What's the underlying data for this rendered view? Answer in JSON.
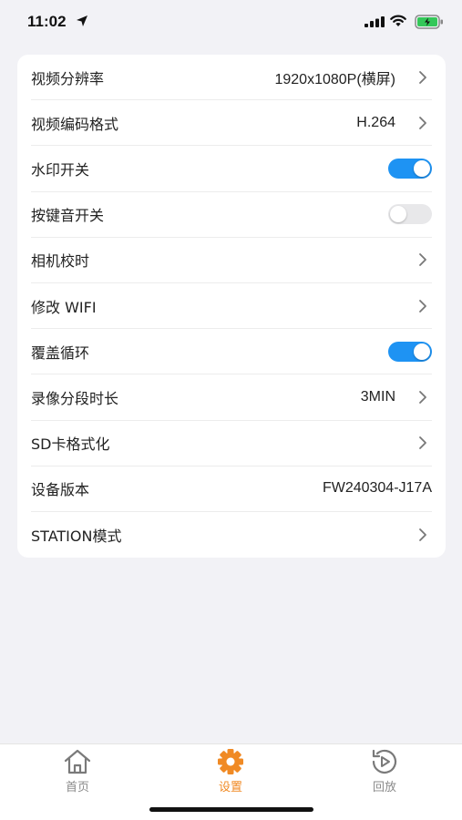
{
  "status_bar": {
    "time": "11:02",
    "icons": [
      "location-arrow-icon",
      "cellular-signal-icon",
      "wifi-icon",
      "battery-charging-icon"
    ]
  },
  "settings": {
    "rows": [
      {
        "label": "视频分辨率",
        "value": "1920x1080P(横屏)",
        "type": "chevron"
      },
      {
        "label": "视频编码格式",
        "value": "H.264",
        "type": "chevron"
      },
      {
        "label": "水印开关",
        "type": "toggle",
        "on": true
      },
      {
        "label": "按键音开关",
        "type": "toggle",
        "on": false
      },
      {
        "label": "相机校时",
        "type": "chevron"
      },
      {
        "label": "修改 WIFI",
        "type": "chevron"
      },
      {
        "label": "覆盖循环",
        "type": "toggle",
        "on": true
      },
      {
        "label": "录像分段时长",
        "value": "3MIN",
        "type": "chevron"
      },
      {
        "label": "SD卡格式化",
        "type": "chevron"
      },
      {
        "label": "设备版本",
        "value": "FW240304-J17A",
        "type": "text"
      },
      {
        "label": "STATION模式",
        "type": "chevron"
      }
    ]
  },
  "tab_bar": {
    "tabs": [
      {
        "label": "首页",
        "icon": "home-icon",
        "active": false
      },
      {
        "label": "设置",
        "icon": "gear-icon",
        "active": true
      },
      {
        "label": "回放",
        "icon": "playback-icon",
        "active": false
      }
    ]
  },
  "colors": {
    "toggle_on": "#1e93f3",
    "toggle_off": "#e8e8ea",
    "active_tab": "#f08a24",
    "inactive_tab": "#8a8a8a",
    "background": "#f2f2f6"
  }
}
